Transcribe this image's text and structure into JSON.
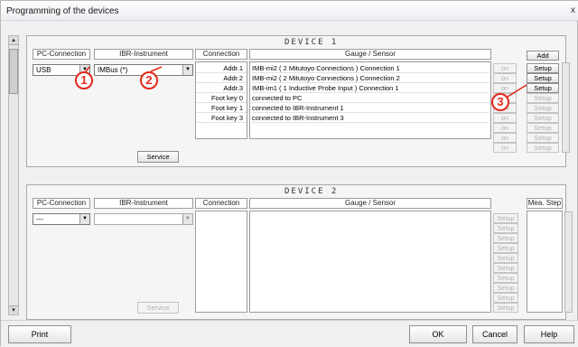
{
  "window": {
    "title": "Programming of the devices",
    "close_glyph": "x"
  },
  "device1": {
    "title": "DEVICE 1",
    "headers": {
      "pc": "PC-Connection",
      "ibr": "IBR-Instrument",
      "conn": "Connection",
      "gauge": "Gauge / Sensor"
    },
    "pc_value": "USB",
    "ibr_value": "IMBus (*)",
    "connections": [
      "Addr.1",
      "Addr.2",
      "Addr.3",
      "Foot key 0",
      "Foot key 1",
      "Foot key 3"
    ],
    "gauges": [
      "IMB-mi2 ( 2 Mitutoyo Connections ) Connection 1",
      "IMB-mi2 ( 2 Mitutoyo Connections ) Connection 2",
      "IMB-im1 ( 1 Inductive Probe Input ) Connection 1",
      "connected to PC",
      "connected to IBR-Instrument 1",
      "connected to IBR-Instrument 3"
    ],
    "on_label": "on",
    "add_label": "Add",
    "setup_label": "Setup",
    "service_label": "Service"
  },
  "device2": {
    "title": "DEVICE 2",
    "headers": {
      "pc": "PC-Connection",
      "ibr": "IBR-Instrument",
      "conn": "Connection",
      "gauge": "Gauge / Sensor",
      "mea": "Mea. Step"
    },
    "pc_value": "---",
    "setup_label": "Setup",
    "service_label": "Service"
  },
  "callouts": [
    "1",
    "2",
    "3"
  ],
  "footer": {
    "print": "Print",
    "ok": "OK",
    "cancel": "Cancel",
    "help": "Help"
  },
  "colors": {
    "callout": "#e32718"
  }
}
